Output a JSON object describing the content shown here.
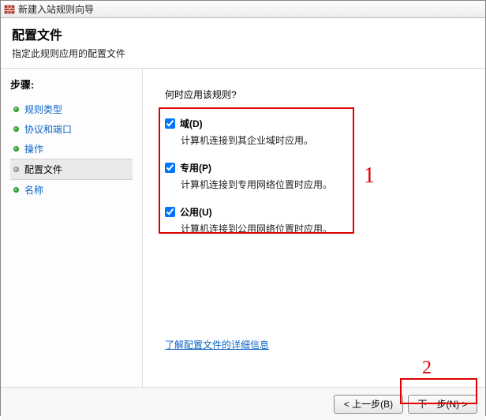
{
  "window": {
    "title": "新建入站规则向导"
  },
  "header": {
    "title": "配置文件",
    "subtitle": "指定此规则应用的配置文件"
  },
  "sidebar": {
    "steps_label": "步骤:",
    "items": [
      {
        "label": "规则类型",
        "state": "link"
      },
      {
        "label": "协议和端口",
        "state": "link"
      },
      {
        "label": "操作",
        "state": "link"
      },
      {
        "label": "配置文件",
        "state": "current"
      },
      {
        "label": "名称",
        "state": "link"
      }
    ]
  },
  "content": {
    "prompt": "何时应用该规则?",
    "options": [
      {
        "label": "域(D)",
        "desc": "计算机连接到其企业域时应用。",
        "checked": true
      },
      {
        "label": "专用(P)",
        "desc": "计算机连接到专用网络位置时应用。",
        "checked": true
      },
      {
        "label": "公用(U)",
        "desc": "计算机连接到公用网络位置时应用。",
        "checked": true
      }
    ],
    "learn_more": "了解配置文件的详细信息"
  },
  "footer": {
    "back": "< 上一步(B)",
    "next": "下一步(N) >"
  },
  "annotations": {
    "one": "1",
    "two": "2"
  }
}
